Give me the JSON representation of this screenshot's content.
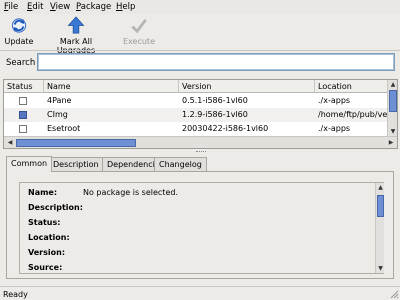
{
  "menubar": {
    "items": [
      {
        "label": "File",
        "mnemonic": "F",
        "rest": "ile"
      },
      {
        "label": "Edit",
        "mnemonic": "E",
        "rest": "dit"
      },
      {
        "label": "View",
        "mnemonic": "V",
        "rest": "iew"
      },
      {
        "label": "Package",
        "mnemonic": "P",
        "rest": "ackage"
      },
      {
        "label": "Help",
        "mnemonic": "H",
        "rest": "elp"
      }
    ]
  },
  "toolbar": {
    "update_label": "Update",
    "mark_all_label": "Mark All Upgrades",
    "execute_label": "Execute",
    "update_icon": "refresh-icon",
    "mark_all_icon": "up-arrow-icon",
    "execute_icon": "checkmark-icon",
    "execute_enabled": false
  },
  "search": {
    "label": "Search",
    "value": ""
  },
  "package_list": {
    "columns": [
      "Status",
      "Name",
      "Version",
      "Location"
    ],
    "rows": [
      {
        "installed": false,
        "name": "4Pane",
        "version": "0.5.1-i586-1vl60",
        "location": "./x-apps"
      },
      {
        "installed": true,
        "name": "CImg",
        "version": "1.2.9-i586-1vl60",
        "location": "/home/ftp/pub/vecli"
      },
      {
        "installed": false,
        "name": "Esetroot",
        "version": "20030422-i586-1vl60",
        "location": "./x-apps"
      }
    ]
  },
  "detail_tabs": [
    "Common",
    "Description",
    "Dependencies",
    "Changelog"
  ],
  "details": {
    "name_label": "Name:",
    "name_value": "No package is selected.",
    "description_label": "Description:",
    "status_label": "Status:",
    "location_label": "Location:",
    "version_label": "Version:",
    "source_label": "Source:"
  },
  "statusbar": {
    "text": "Ready"
  },
  "colors": {
    "accent": "#5676c2",
    "scroll_thumb": "#6d8fd4",
    "window_bg": "#ecebe8"
  }
}
